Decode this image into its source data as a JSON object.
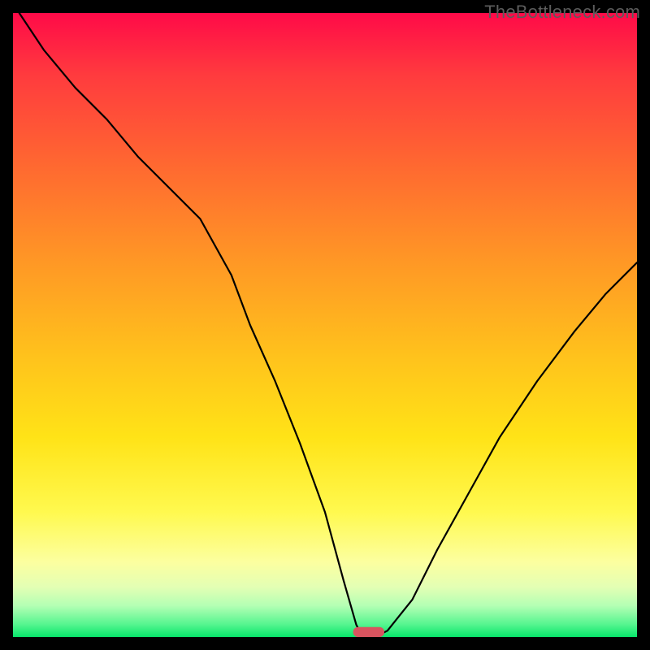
{
  "watermark": "TheBottleneck.com",
  "chart_data": {
    "type": "line",
    "title": "",
    "xlabel": "",
    "ylabel": "",
    "xlim": [
      0,
      100
    ],
    "ylim": [
      0,
      100
    ],
    "grid": false,
    "series": [
      {
        "name": "bottleneck-curve",
        "x": [
          1,
          5,
          10,
          15,
          20,
          25,
          30,
          35,
          38,
          42,
          46,
          50,
          53,
          55,
          56,
          58,
          60,
          64,
          68,
          73,
          78,
          84,
          90,
          95,
          100
        ],
        "values": [
          100,
          94,
          88,
          83,
          77,
          72,
          67,
          58,
          50,
          41,
          31,
          20,
          9,
          2,
          0,
          0,
          1,
          6,
          14,
          23,
          32,
          41,
          49,
          55,
          60
        ]
      }
    ],
    "marker": {
      "name": "optimal-marker",
      "x": 57,
      "y": 0,
      "color": "#d8545f",
      "width_pct": 5,
      "height_pct": 1.6
    }
  }
}
